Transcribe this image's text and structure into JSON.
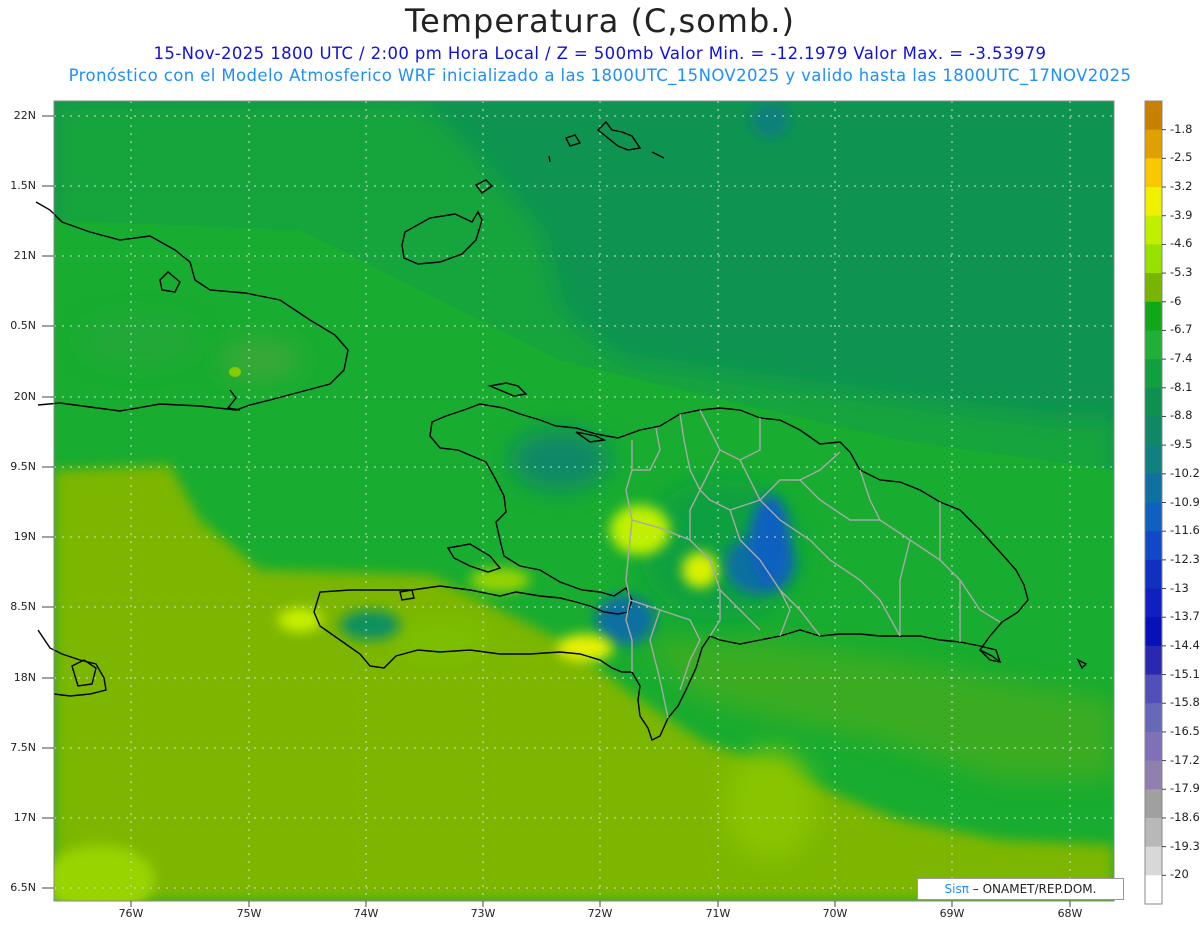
{
  "title": "Temperatura (C,somb.)",
  "subtitle_line1": "15-Nov-2025  1800 UTC / 2:00 pm Hora Local / Z = 500mb  Valor Min. = -12.1979  Valor Max. = -3.53979",
  "subtitle_line2": "Pronóstico con el Modelo Atmosferico WRF inicializado a las 1800UTC_15NOV2025 y valido hasta las  1800UTC_17NOV2025",
  "credit": {
    "brand": "Sisπ",
    "text": " – ONAMET/REP.DOM."
  },
  "y_ticks": [
    "22N",
    "1.5N",
    "21N",
    "0.5N",
    "20N",
    "9.5N",
    "19N",
    "8.5N",
    "18N",
    "7.5N",
    "17N",
    "6.5N"
  ],
  "x_ticks": [
    "76W",
    "75W",
    "74W",
    "73W",
    "72W",
    "71W",
    "70W",
    "69W",
    "68W"
  ],
  "colorbar": {
    "labels": [
      "-1.8",
      "-2.5",
      "-3.2",
      "-3.9",
      "-4.6",
      "-5.3",
      "-6",
      "-6.7",
      "-7.4",
      "-8.1",
      "-8.8",
      "-9.5",
      "-10.2",
      "-10.9",
      "-11.6",
      "-12.3",
      "-13",
      "-13.7",
      "-14.4",
      "-15.1",
      "-15.8",
      "-16.5",
      "-17.2",
      "-17.9",
      "-18.6",
      "-19.3",
      "-20"
    ],
    "colors": [
      "#c88000",
      "#e0a000",
      "#f8c800",
      "#f0f000",
      "#c0f000",
      "#98e000",
      "#78b400",
      "#10a818",
      "#20b038",
      "#10a040",
      "#109050",
      "#108868",
      "#108080",
      "#1070a0",
      "#1060c0",
      "#1048c8",
      "#1030c0",
      "#1020c0",
      "#0810b8",
      "#2828b0",
      "#5050b8",
      "#6868b8",
      "#8070b8",
      "#9080b0",
      "#a0a0a0",
      "#b8b8b8",
      "#d8d8d8",
      "#ffffff"
    ]
  }
}
